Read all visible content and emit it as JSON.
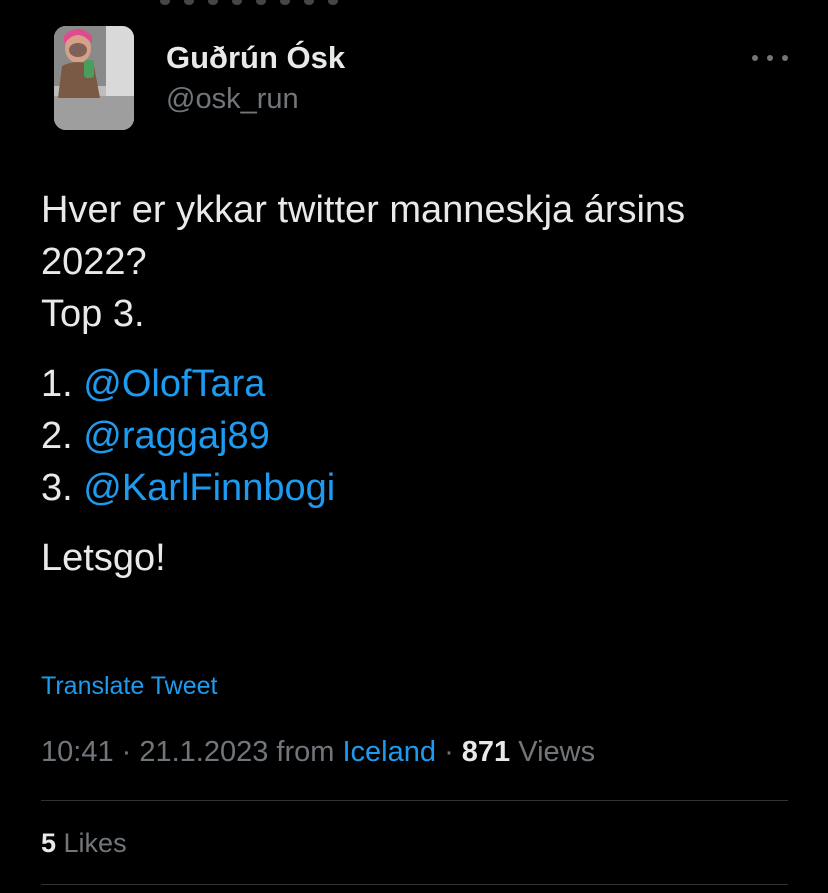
{
  "author": {
    "display_name": "Guðrún Ósk",
    "handle": "@osk_run"
  },
  "tweet": {
    "line1": "Hver er ykkar twitter manneskja ársins 2022?",
    "line2": "Top 3.",
    "ranking": [
      {
        "num": "1. ",
        "mention": "@OlofTara"
      },
      {
        "num": "2. ",
        "mention": "@raggaj89"
      },
      {
        "num": "3. ",
        "mention": "@KarlFinnbogi"
      }
    ],
    "closing": "Letsgo!"
  },
  "translate_label": "Translate Tweet",
  "meta": {
    "time": "10:41",
    "sep1": " · ",
    "date": "21.1.2023",
    "from_label": " from ",
    "location": "Iceland",
    "sep2": " · ",
    "views_count": "871",
    "views_label": " Views"
  },
  "engagement": {
    "likes_count": "5",
    "likes_label": " Likes"
  },
  "colors": {
    "background": "#000000",
    "text": "#e7e9ea",
    "secondary": "#71767b",
    "accent": "#1d9bf0",
    "divider": "#2f3336"
  },
  "icons": {
    "more": "more-horizontal-icon"
  }
}
